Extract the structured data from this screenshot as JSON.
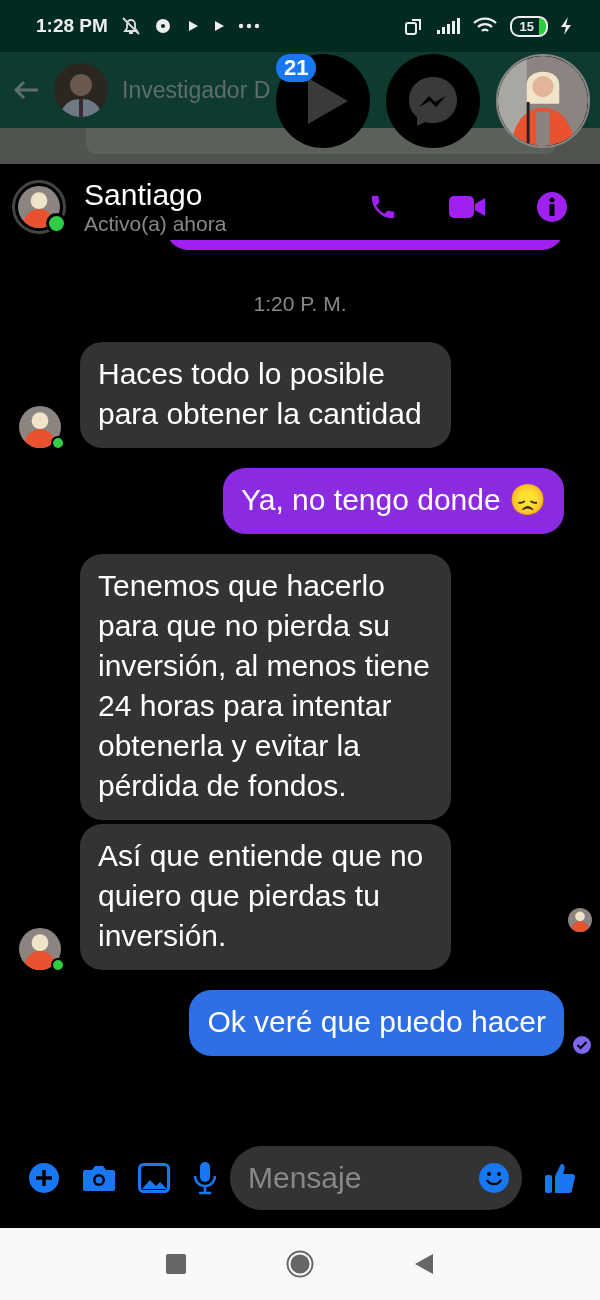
{
  "status_bar": {
    "time": "1:28 PM",
    "battery": "15"
  },
  "background_app": {
    "title": "Investigador D"
  },
  "chat_heads": {
    "badge": "21"
  },
  "conversation": {
    "name": "Santiago",
    "status": "Activo(a) ahora",
    "online": true
  },
  "timestamp": "1:20 P. M.",
  "messages": [
    {
      "kind": "incoming",
      "text": "Haces todo lo posible para obtener la cantidad",
      "show_avatar": true
    },
    {
      "kind": "outgoing",
      "text": "Ya, no tengo donde 😞",
      "color": "#8a2be2"
    },
    {
      "kind": "incoming",
      "text": "Tenemos que hacerlo para que no pierda su inversión, al menos tiene 24 horas para intentar obtenerla y evitar la pérdida de fondos.",
      "show_avatar": false
    },
    {
      "kind": "incoming",
      "text": "Así que entiende que no quiero que pierdas tu inversión.",
      "show_avatar": true,
      "seen": true
    },
    {
      "kind": "outgoing",
      "text": "Ok veré que puedo hacer",
      "color": "#2f6fe6",
      "delivered": true
    }
  ],
  "composer": {
    "placeholder": "Mensaje"
  }
}
